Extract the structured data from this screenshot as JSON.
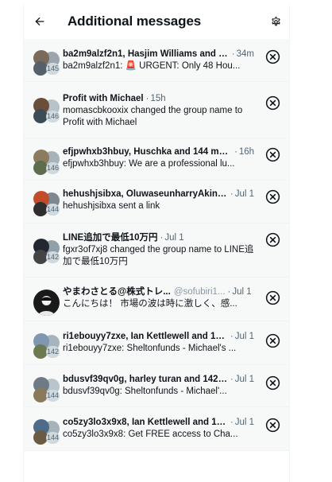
{
  "header": {
    "title": "Additional messages"
  },
  "icons": {
    "back": "arrow-left-icon",
    "settings": "gear-icon",
    "dismiss": "close-circle-icon"
  },
  "colors": {
    "text_primary": "#0f1419",
    "text_secondary": "#536471",
    "list_background": "#f7f9f9",
    "count_badge": "#cfd9de"
  },
  "messages": [
    {
      "name": "ba2m9alzf2n1, Hasjim Williams and 1...",
      "handle": "",
      "time": "34m",
      "count": "145",
      "preview": "ba2m9alzf2n1: 🚨 URGENT: Only 48 Hou..."
    },
    {
      "name": "Profit with Michael",
      "handle": "",
      "time": "15h",
      "count": "146",
      "preview": "momascbkooxix changed the group name to Profit with Michael"
    },
    {
      "name": "efjpwhxb3hbuy, Huschka and 144 more",
      "handle": "",
      "time": "16h",
      "count": "146",
      "preview": "efjpwhxb3hbuy: We are a professional lu..."
    },
    {
      "name": "hehushjsibxa, OluwaseunharryAkin. a...",
      "handle": "",
      "time": "Jul 1",
      "count": "144",
      "preview": "hehushjsibxa sent a link"
    },
    {
      "name": "LINE追加で最低10万円",
      "handle": "",
      "time": "Jul 1",
      "count": "142",
      "preview": "fgxr3of7xj8 changed the group name to LINE追加で最低10万円"
    },
    {
      "name": "やまわさとる@株式トレ...",
      "handle": "@sofubiri1...",
      "time": "Jul 1",
      "count": "",
      "preview": "こんにちは！ 市場の波は時に激しく、感..."
    },
    {
      "name": "ri1ebouyy7zxe, Ian Kettlewell and 140 ...",
      "handle": "",
      "time": "Jul 1",
      "count": "142",
      "preview": "ri1ebouyy7zxe: Sheltonfunds - Michael's ..."
    },
    {
      "name": "bdusvf39qv0g, harley turan and 142 ...",
      "handle": "",
      "time": "Jul 1",
      "count": "144",
      "preview": "bdusvf39qv0g: Sheltonfunds - Michael'..."
    },
    {
      "name": "co5zy3lo3x9x8, Ian Kettlewell and 14...",
      "handle": "",
      "time": "Jul 1",
      "count": "144",
      "preview": "co5zy3lo3x9x8: Get FREE access to Cha..."
    }
  ]
}
